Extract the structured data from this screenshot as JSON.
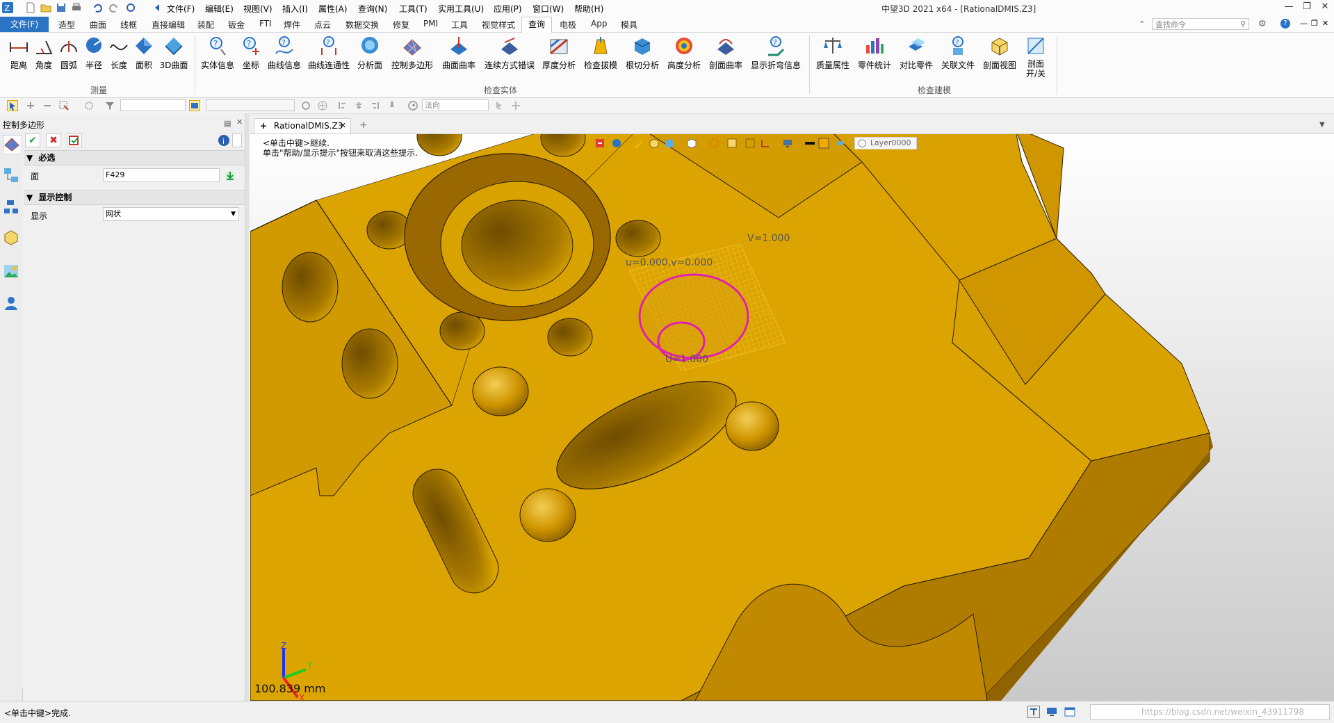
{
  "window": {
    "title": "中望3D 2021 x64 - [RationalDMIS.Z3]",
    "minimize_icon": "minimize-icon",
    "maximize_icon": "restore-icon",
    "close_icon": "close-icon"
  },
  "menubar": {
    "items": [
      "文件(F)",
      "编辑(E)",
      "视图(V)",
      "插入(I)",
      "属性(A)",
      "查询(N)",
      "工具(T)",
      "实用工具(U)",
      "应用(P)",
      "窗口(W)",
      "帮助(H)"
    ]
  },
  "ribbon_tabs": {
    "file": "文件(F)",
    "items": [
      "造型",
      "曲面",
      "线框",
      "直接编辑",
      "装配",
      "钣金",
      "FTI",
      "焊件",
      "点云",
      "数据交换",
      "修复",
      "PMI",
      "工具",
      "视觉样式",
      "查询",
      "电极",
      "App",
      "模具"
    ],
    "active": "查询",
    "search_placeholder": "查找命令"
  },
  "ribbon": {
    "groups": [
      {
        "label": "测量",
        "buttons": [
          "距离",
          "角度",
          "圆弧",
          "半径",
          "长度",
          "面积",
          "3D曲面"
        ]
      },
      {
        "label": "检查实体",
        "buttons": [
          "实体信息",
          "坐标",
          "曲线信息",
          "曲线连通性",
          "分析面",
          "控制多边形",
          "曲面曲率",
          "连续方式错误",
          "厚度分析",
          "检查拔模",
          "根切分析",
          "高度分析",
          "剖面曲率",
          "显示折弯信息"
        ]
      },
      {
        "label": "检查建模",
        "buttons": [
          "质量属性",
          "零件统计",
          "对比零件",
          "关联文件",
          "剖面视图",
          "剖面 开/关"
        ]
      }
    ]
  },
  "toolbar2": {
    "filter_value": "",
    "direction_value": "法向"
  },
  "left_panel": {
    "title": "控制多边形",
    "section_required": "必选",
    "face_label": "面",
    "face_value": "F429",
    "section_display": "显示控制",
    "display_label": "显示",
    "display_value": "网状"
  },
  "document": {
    "tab_label": "RationalDMIS.Z3",
    "hint_line1": "<单击中键>继续.",
    "hint_line2": "单击\"帮助/显示提示\"按钮来取消这些提示.",
    "layer": "Layer0000",
    "annot_uv": "u=0.000,v=0.000",
    "annot_v": "V=1.000",
    "annot_u": "U=1.000",
    "scale": "100.839 mm",
    "axis_x": "X",
    "axis_y": "Y",
    "axis_z": "Z"
  },
  "status": {
    "text": "<单击中键>完成.",
    "watermark": "https://blog.csdn.net/weixin_43911798"
  },
  "colors": {
    "part": "#dca000",
    "part_dark": "#9a6a00",
    "accent": "#2b73c5",
    "highlight": "#e020b0"
  }
}
